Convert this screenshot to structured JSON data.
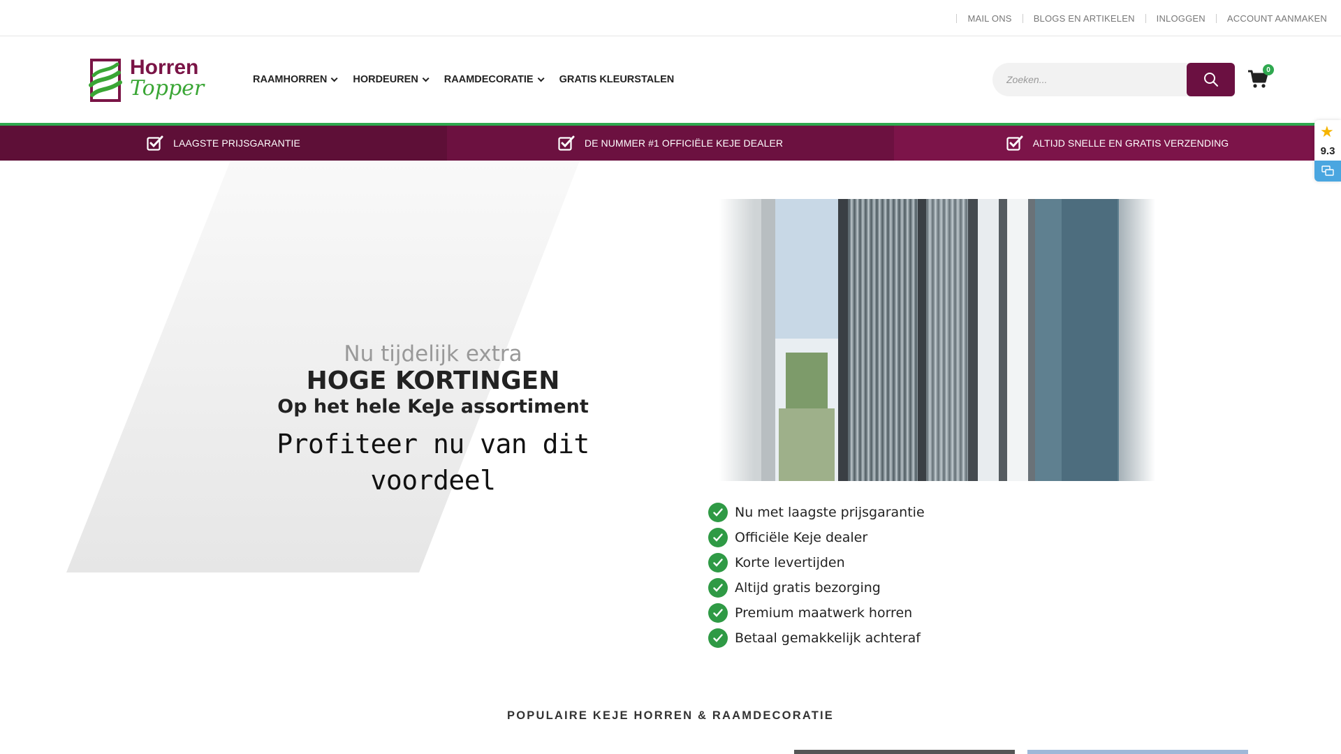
{
  "topbar": {
    "links": [
      "MAIL ONS",
      "BLOGS EN ARTIKELEN",
      "INLOGGEN",
      "ACCOUNT AANMAKEN"
    ]
  },
  "logo": {
    "line1": "Horren",
    "line2": "Topper"
  },
  "nav": {
    "items": [
      {
        "label": "RAAMHORREN",
        "has_dropdown": true
      },
      {
        "label": "HORDEUREN",
        "has_dropdown": true
      },
      {
        "label": "RAAMDECORATIE",
        "has_dropdown": true
      },
      {
        "label": "GRATIS KLEURSTALEN",
        "has_dropdown": false
      }
    ]
  },
  "search": {
    "placeholder": "Zoeken..."
  },
  "cart": {
    "count": "0"
  },
  "usps": [
    "LAAGSTE PRIJSGARANTIE",
    "DE NUMMER #1 OFFICIËLE KEJE DEALER",
    "ALTIJD SNELLE EN GRATIS VERZENDING"
  ],
  "review": {
    "score": "9.3"
  },
  "hero": {
    "line1": "Nu tijdelijk extra",
    "line2": "HOGE KORTINGEN",
    "line3": "Op het hele KeJe assortiment",
    "line4": "Profiteer nu van dit voordeel"
  },
  "benefits": [
    "Nu met laagste prijsgarantie",
    "Officiële Keje dealer",
    "Korte levertijden",
    "Altijd gratis bezorging",
    "Premium maatwerk horren",
    "Betaal gemakkelijk achteraf"
  ],
  "section_title": "POPULAIRE KEJE HORREN & RAAMDECORATIE",
  "colors": {
    "brand": "#6b1041",
    "accent_green": "#2fa84f",
    "usp_1": "#5e0f37",
    "usp_2": "#6c1140",
    "usp_3": "#7c1449"
  }
}
